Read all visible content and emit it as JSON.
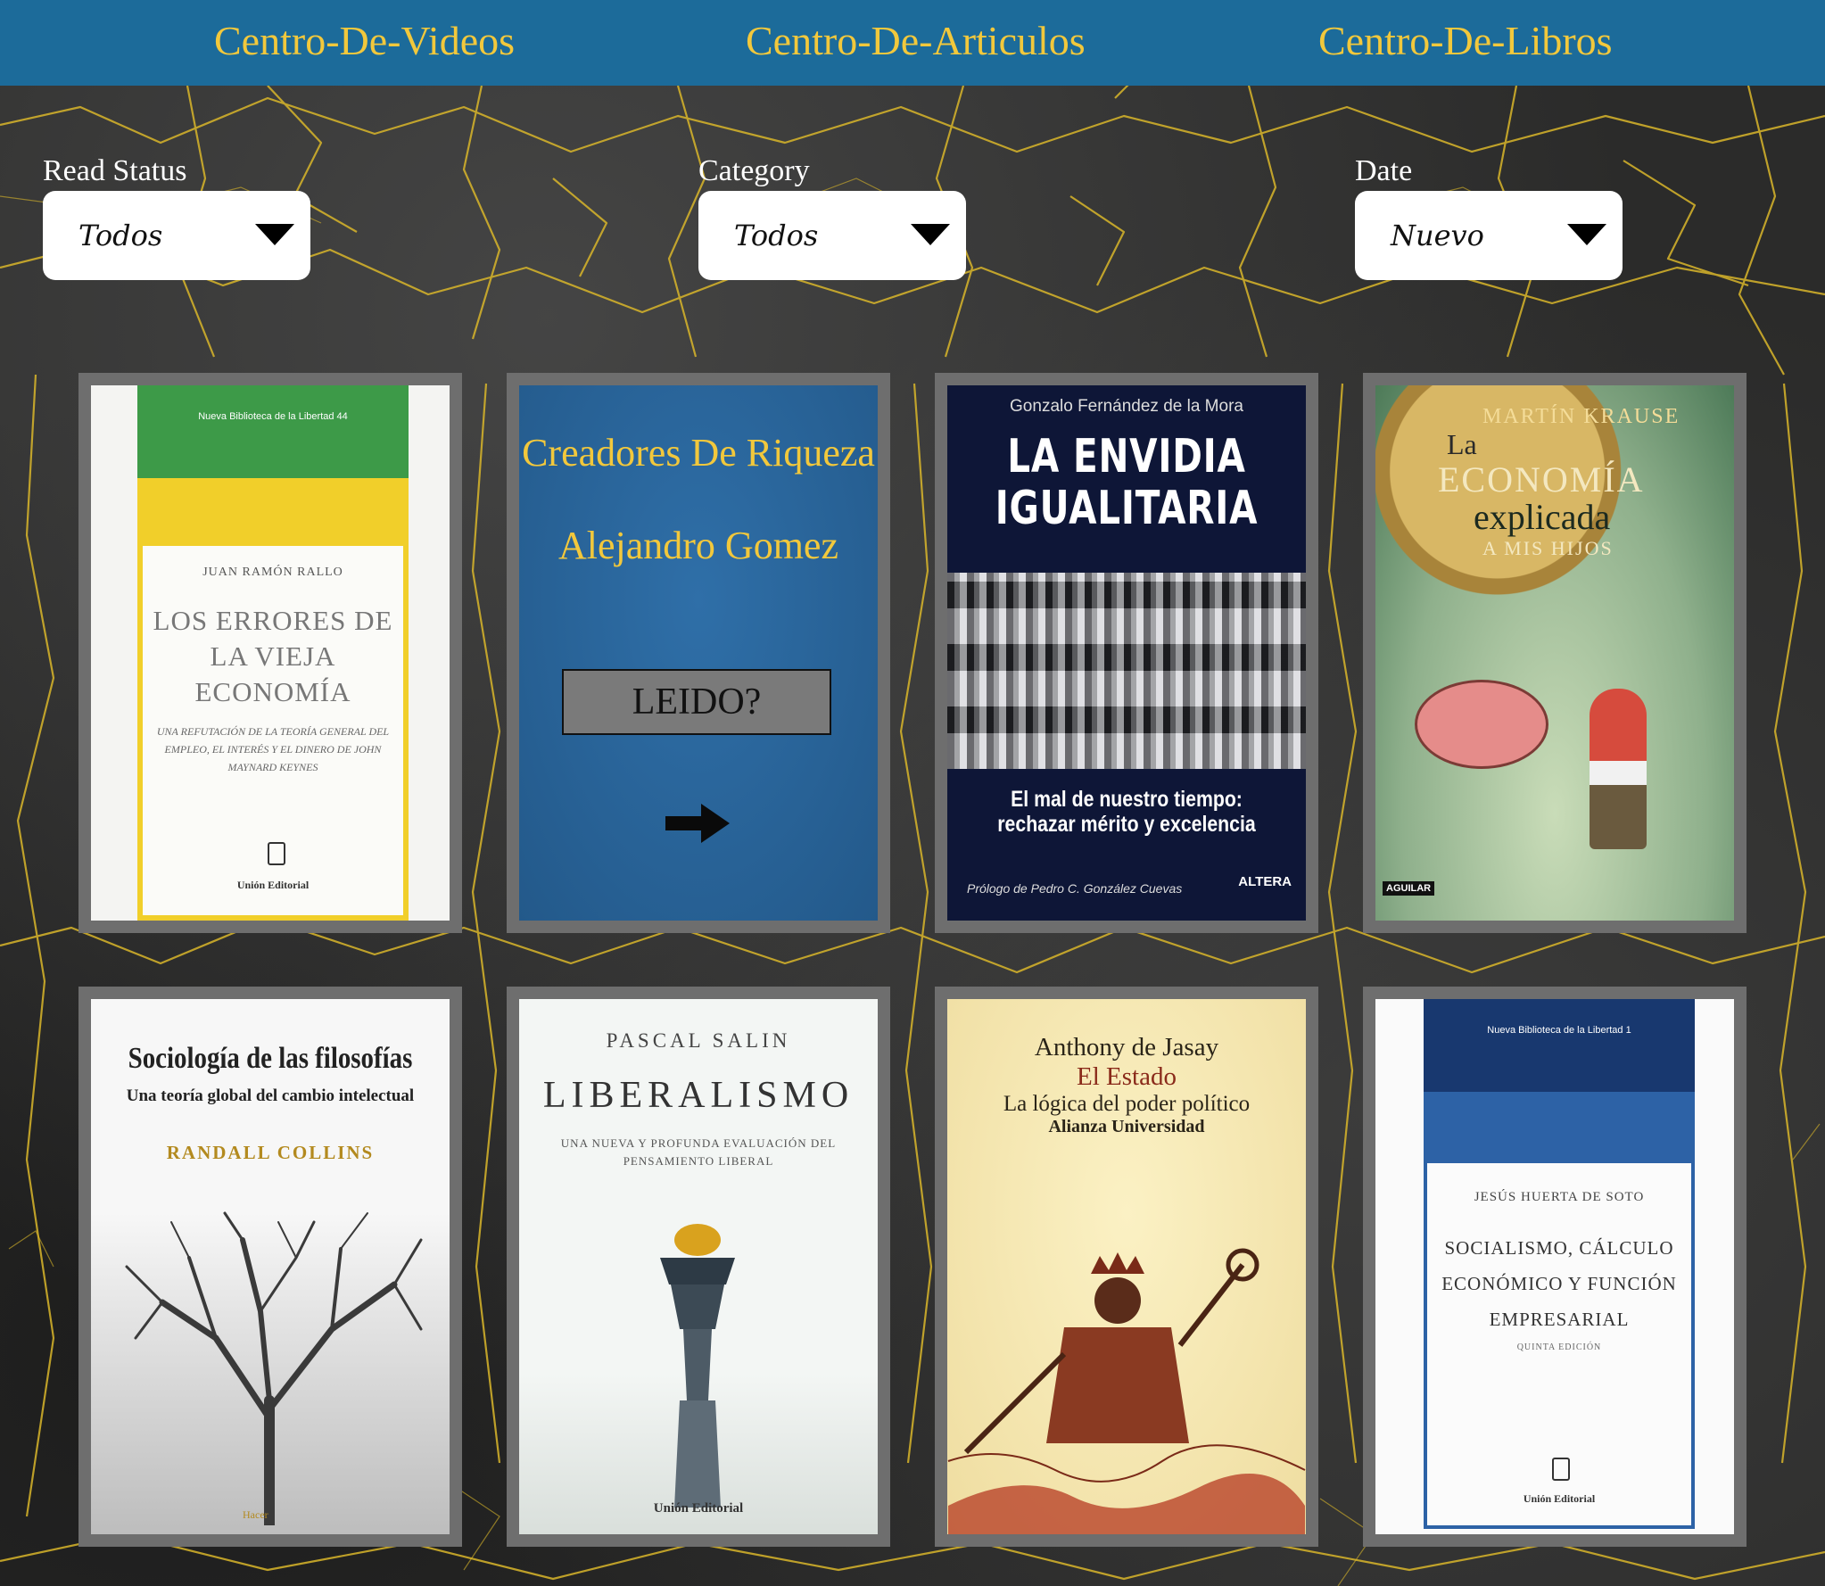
{
  "nav": {
    "videos": "Centro-De-Videos",
    "articulos": "Centro-De-Articulos",
    "libros": "Centro-De-Libros"
  },
  "filters": {
    "read_status": {
      "label": "Read Status",
      "value": "Todos"
    },
    "category": {
      "label": "Category",
      "value": "Todos"
    },
    "date": {
      "label": "Date",
      "value": "Nuevo"
    }
  },
  "books": [
    {
      "series": "Nueva Biblioteca de la Libertad 44",
      "author": "JUAN RAMÓN RALLO",
      "title": "LOS ERRORES DE LA VIEJA ECONOMÍA",
      "subtitle": "UNA REFUTACIÓN DE LA TEORÍA GENERAL DEL EMPLEO, EL INTERÉS Y EL DINERO DE JOHN MAYNARD KEYNES",
      "publisher": "Unión Editorial"
    },
    {
      "title": "Creadores De Riqueza",
      "author": "Alejandro Gomez",
      "button": "LEIDO?"
    },
    {
      "author": "Gonzalo Fernández de la Mora",
      "title": "LA ENVIDIA IGUALITARIA",
      "subtitle": "El mal de nuestro tiempo: rechazar mérito y excelencia",
      "prologue": "Prólogo de Pedro C. González Cuevas",
      "publisher": "ALTERA"
    },
    {
      "author": "MARTÍN KRAUSE",
      "title_1": "La",
      "title_2": "ECONOMÍA",
      "title_3": "explicada",
      "title_4": "A MIS HIJOS",
      "publisher": "AGUILAR"
    },
    {
      "title": "Sociología de las filosofías",
      "subtitle": "Una teoría global del cambio intelectual",
      "author": "RANDALL COLLINS",
      "publisher": "Hacer"
    },
    {
      "author": "PASCAL SALIN",
      "title": "LIBERALISMO",
      "subtitle": "UNA NUEVA Y PROFUNDA EVALUACIÓN DEL PENSAMIENTO LIBERAL",
      "publisher": "Unión Editorial"
    },
    {
      "author": "Anthony de Jasay",
      "title": "El Estado",
      "subtitle": "La lógica del poder político",
      "publisher": "Alianza Universidad"
    },
    {
      "series": "Nueva Biblioteca de la Libertad 1",
      "author": "JESÚS HUERTA DE SOTO",
      "title": "SOCIALISMO, CÁLCULO ECONÓMICO Y FUNCIÓN EMPRESARIAL",
      "edition": "QUINTA EDICIÓN",
      "publisher": "Unión Editorial"
    }
  ],
  "colors": {
    "nav_bg": "#1c6b9a",
    "nav_text": "#f2c83c",
    "card_frame": "#6e6e6e",
    "crack": "#d9b62a"
  }
}
